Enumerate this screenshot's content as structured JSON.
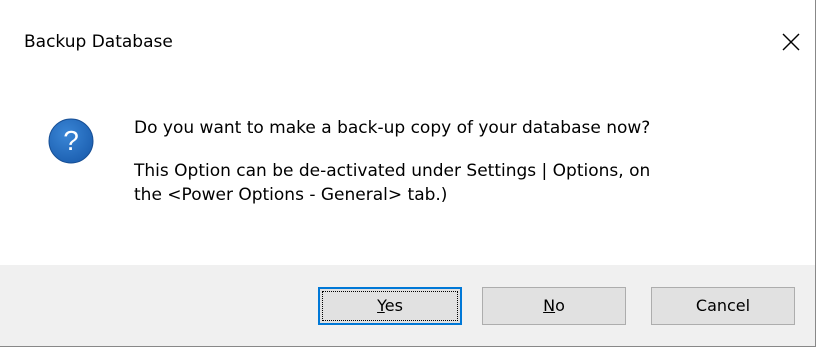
{
  "dialog": {
    "title": "Backup Database",
    "close_symbol": "×",
    "icon": "question-icon",
    "icon_glyph": "?",
    "message": {
      "line1": "Do you want to make a back-up copy of your database now?",
      "line2": "This Option can be de-activated under Settings | Options, on",
      "line3": "the <Power Options - General> tab.)"
    },
    "buttons": {
      "yes": {
        "mnemonic": "Y",
        "rest": "es",
        "default": true
      },
      "no": {
        "mnemonic": "N",
        "rest": "o"
      },
      "cancel": {
        "label": "Cancel"
      }
    },
    "colors": {
      "icon_fill": "#1c5fb0",
      "default_button_border": "#0078d7",
      "button_face": "#e1e1e1",
      "footer_background": "#f0f0f0"
    }
  }
}
